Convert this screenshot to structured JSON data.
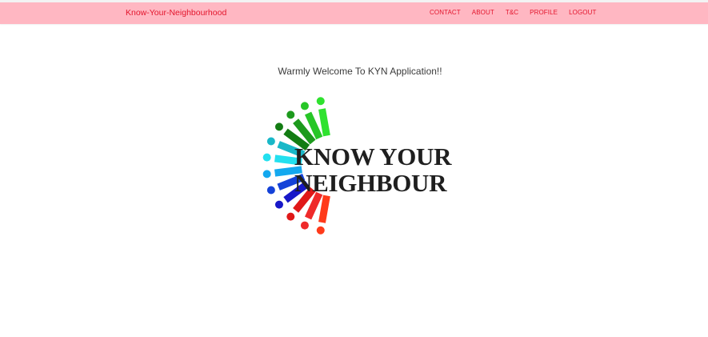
{
  "navbar": {
    "brand": "Know-Your-Neighbourhood",
    "links": [
      "CONTACT",
      "ABOUT",
      "T&C",
      "PROFILE",
      "LOGOUT"
    ],
    "background": "#ffb7c2",
    "text_color": "#e3152c"
  },
  "main": {
    "welcome_text": "Warmly Welcome To KYN Application!!",
    "logo": {
      "line1": "KNOW YOUR",
      "line2": "NEIGHBOUR"
    }
  }
}
